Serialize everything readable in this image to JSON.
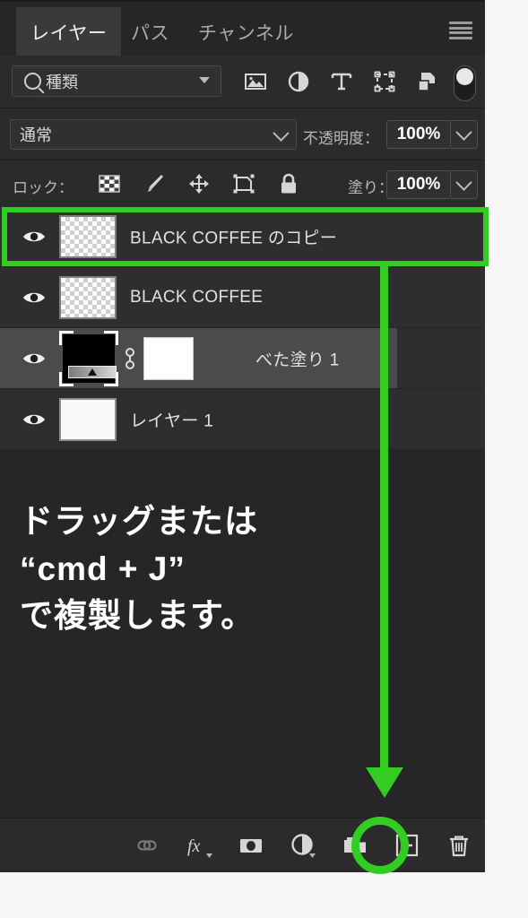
{
  "panel": {
    "tabs": [
      {
        "label": "レイヤー",
        "name": "tab-layers",
        "active": true
      },
      {
        "label": "パス",
        "name": "tab-paths",
        "active": false
      },
      {
        "label": "チャンネル",
        "name": "tab-channels",
        "active": false
      }
    ],
    "menu_icon": "hamburger-menu-icon"
  },
  "filter": {
    "search_value": "種類",
    "icons": [
      "image-filter-icon",
      "adjustment-filter-icon",
      "text-filter-icon",
      "shape-filter-icon",
      "smart-object-filter-icon"
    ],
    "toggle": "filter-enable-toggle"
  },
  "blend": {
    "mode_value": "通常",
    "opacity_label": "不透明度：",
    "opacity_value": "100%"
  },
  "lock": {
    "label": "ロック：",
    "icons": [
      "lock-transparency-icon",
      "lock-image-icon",
      "lock-position-icon",
      "lock-artboard-icon",
      "lock-all-icon"
    ],
    "fill_label": "塗り：",
    "fill_value": "100%"
  },
  "layers": [
    {
      "name": "BLACK COFFEE のコピー",
      "thumb": "transparent",
      "visible": true,
      "selected": false,
      "highlighted": true
    },
    {
      "name": "BLACK COFFEE",
      "thumb": "transparent",
      "visible": true,
      "selected": false,
      "highlighted": false
    },
    {
      "name": "べた塗り 1",
      "thumb": "mask-gradient",
      "visible": true,
      "selected": true,
      "highlighted": false
    },
    {
      "name": "レイヤー 1",
      "thumb": "white",
      "visible": true,
      "selected": false,
      "highlighted": false
    }
  ],
  "instructions": {
    "line1": "ドラッグまたは",
    "line2": "“cmd + J”",
    "line3": "で複製します。"
  },
  "toolbar": {
    "icons": [
      {
        "name": "link-layers-icon",
        "label": "リンク"
      },
      {
        "name": "layer-style-fx-icon",
        "label": "fx"
      },
      {
        "name": "add-layer-mask-icon",
        "label": "マスク"
      },
      {
        "name": "new-adjustment-layer-icon",
        "label": "調整レイヤー"
      },
      {
        "name": "new-group-icon",
        "label": "グループ"
      },
      {
        "name": "new-layer-icon",
        "label": "新規レイヤー"
      },
      {
        "name": "delete-layer-icon",
        "label": "削除"
      }
    ]
  },
  "annotations": {
    "accent_color": "#33cc22",
    "highlight_target": "BLACK COFFEE のコピー",
    "arrow_target": "new-layer-icon"
  }
}
